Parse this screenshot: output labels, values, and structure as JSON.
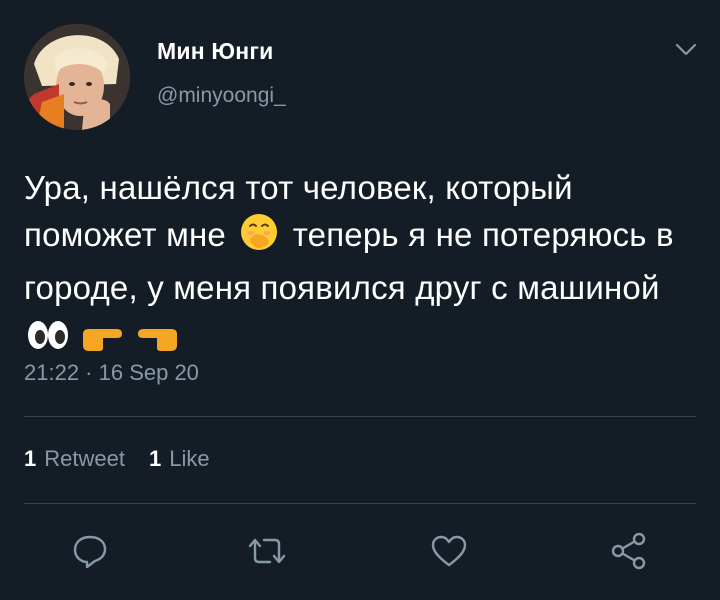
{
  "user": {
    "display_name": "Мин Юнги",
    "handle": "@minyoongi_",
    "avatar_icon": "user-avatar"
  },
  "tweet": {
    "text_part1": "Ура, нашёлся тот человек, который поможет мне",
    "text_part2": "теперь я не потеряюсь в городе, у меня появился друг с машиной",
    "emoji_1": "hand-over-mouth-face-emoji",
    "emoji_2": "eyes-emoji",
    "emoji_3": "pointing-right-emoji",
    "emoji_4": "pointing-left-emoji",
    "timestamp": "21:22 · 16 Sep 20"
  },
  "stats": {
    "retweet_count": "1",
    "retweet_label": "Retweet",
    "like_count": "1",
    "like_label": "Like"
  },
  "actions": {
    "reply_icon": "reply-icon",
    "retweet_icon": "retweet-icon",
    "like_icon": "like-icon",
    "share_icon": "share-icon"
  },
  "colors": {
    "background": "#141d26",
    "primary_text": "#ffffff",
    "secondary_text": "#8899a6",
    "divider": "#38444d"
  }
}
